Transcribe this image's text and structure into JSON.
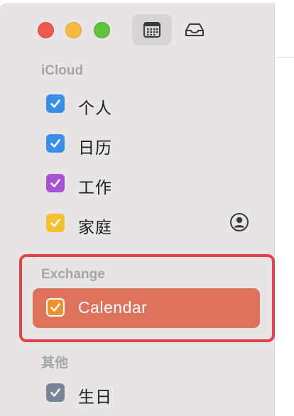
{
  "window": {
    "toolbar": {
      "calendar_view_icon": "calendar-icon",
      "inbox_icon": "inbox-icon"
    }
  },
  "sidebar": {
    "groups": [
      {
        "header": "iCloud",
        "items": [
          {
            "label": "个人",
            "checked": true,
            "color": "#3b8fe6"
          },
          {
            "label": "日历",
            "checked": true,
            "color": "#3b8fe6"
          },
          {
            "label": "工作",
            "checked": true,
            "color": "#a751d3"
          },
          {
            "label": "家庭",
            "checked": true,
            "color": "#f5c02f",
            "shared_icon": "person-circle-icon"
          }
        ]
      },
      {
        "header": "Exchange",
        "items": [
          {
            "label": "Calendar",
            "checked": true,
            "color": "#f0912e",
            "selected": true
          }
        ]
      },
      {
        "header": "其他",
        "items": [
          {
            "label": "生日",
            "checked": true,
            "color": "#7a8498"
          }
        ]
      }
    ]
  },
  "colors": {
    "sidebar_bg": "#e7e5e6",
    "selection": "#dd735d",
    "highlight_border": "#e5434c"
  }
}
